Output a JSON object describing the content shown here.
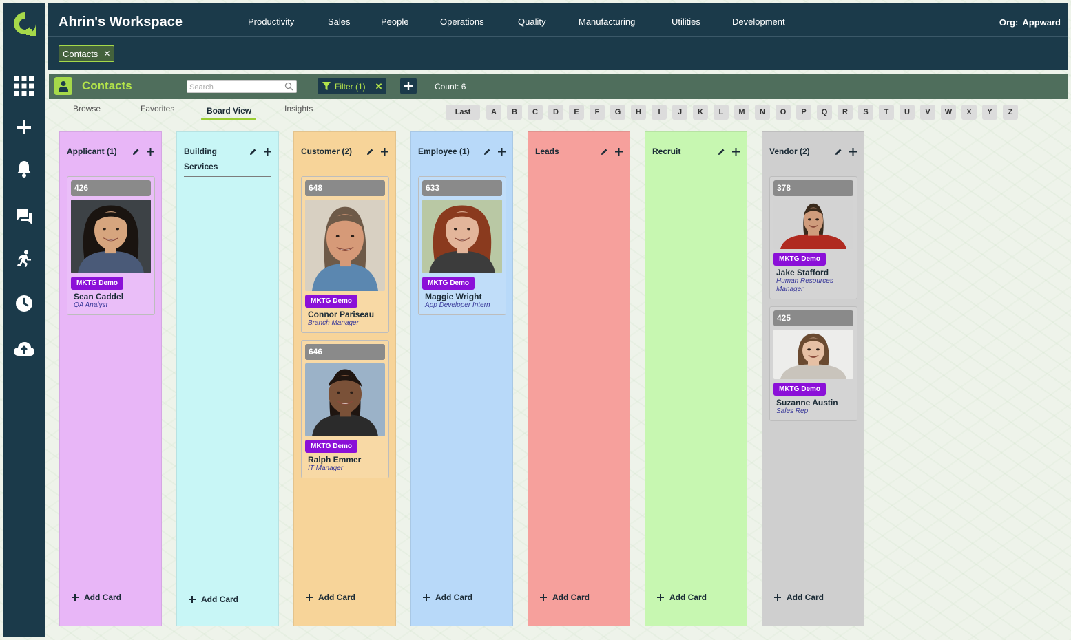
{
  "header": {
    "workspace_title": "Ahrin's Workspace",
    "nav": [
      "Productivity",
      "Sales",
      "People",
      "Operations",
      "Quality",
      "Manufacturing",
      "Utilities",
      "Development"
    ],
    "org_label": "Org:",
    "org_name": "Appward",
    "open_tab": "Contacts",
    "open_tab_close": "✕"
  },
  "rail": {
    "icons": [
      "apps-grid-icon",
      "plus-icon",
      "bell-icon",
      "chat-icon",
      "runner-icon",
      "clock-icon",
      "cloud-upload-icon"
    ]
  },
  "toolbar": {
    "title": "Contacts",
    "search_placeholder": "Search",
    "filter_label": "Filter (1)",
    "filter_clear": "✕",
    "count": "Count: 6"
  },
  "tabs": [
    "Browse",
    "Favorites",
    "Board View",
    "Insights"
  ],
  "active_tab": "Board View",
  "alphabet": [
    "Last",
    "A",
    "B",
    "C",
    "D",
    "E",
    "F",
    "G",
    "H",
    "I",
    "J",
    "K",
    "L",
    "M",
    "N",
    "O",
    "P",
    "Q",
    "R",
    "S",
    "T",
    "U",
    "V",
    "W",
    "X",
    "Y",
    "Z"
  ],
  "add_card_label": "Add Card",
  "colors": {
    "brand": "#a6d94a",
    "header_bg": "#1b3a4a",
    "toolbar_bg": "#4f6e5c",
    "tag": "#8b10d8"
  },
  "columns": [
    {
      "title": "Applicant (1)",
      "color": "#e8b6f7",
      "cards": [
        {
          "id": "426",
          "tag": "MKTG Demo",
          "name": "Sean Caddel",
          "role": "QA Analyst"
        }
      ]
    },
    {
      "title": "Building Services",
      "color": "#c8f6f6",
      "cards": []
    },
    {
      "title": "Customer (2)",
      "color": "#f7d499",
      "cards": [
        {
          "id": "648",
          "tag": "MKTG Demo",
          "name": "Connor Pariseau",
          "role": "Branch Manager"
        },
        {
          "id": "646",
          "tag": "MKTG Demo",
          "name": "Ralph Emmer",
          "role": "IT Manager"
        }
      ]
    },
    {
      "title": "Employee (1)",
      "color": "#b8d9f9",
      "cards": [
        {
          "id": "633",
          "tag": "MKTG Demo",
          "name": "Maggie Wright",
          "role": "App Developer Intern"
        }
      ]
    },
    {
      "title": "Leads",
      "color": "#f6a09c",
      "cards": []
    },
    {
      "title": "Recruit",
      "color": "#c7f7b1",
      "cards": []
    },
    {
      "title": "Vendor (2)",
      "color": "#cfcfcf",
      "cards": [
        {
          "id": "378",
          "tag": "MKTG Demo",
          "name": "Jake Stafford",
          "role": "Human Resources Manager"
        },
        {
          "id": "425",
          "tag": "MKTG Demo",
          "name": "Suzanne Austin",
          "role": "Sales Rep"
        }
      ]
    }
  ]
}
